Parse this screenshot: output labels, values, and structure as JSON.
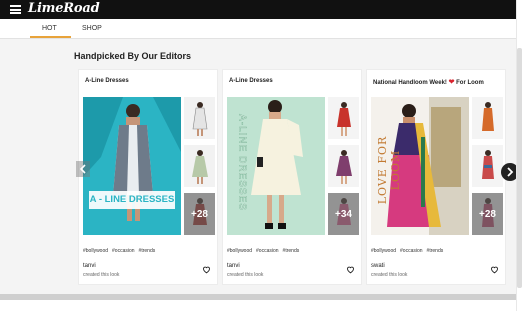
{
  "app": {
    "logo": "LimeRoad"
  },
  "tabs": [
    {
      "label": "HOT",
      "active": true
    },
    {
      "label": "SHOP",
      "active": false
    }
  ],
  "section": {
    "title": "Handpicked By Our Editors"
  },
  "cards": [
    {
      "title": "A-Line Dresses",
      "hero_text": "A - LINE DRESSES",
      "more_count": "+28",
      "tags": [
        "#bollywood",
        "#occasion",
        "#trends"
      ],
      "user": "tanvi",
      "created": "created this look"
    },
    {
      "title": "A-Line Dresses",
      "hero_text": "A-LINE DRESSES",
      "more_count": "+34",
      "tags": [
        "#bollywood",
        "#occasion",
        "#trends"
      ],
      "user": "tanvi",
      "created": "created this look"
    },
    {
      "title": "National Handloom Week!",
      "title_suffix": "For Loom",
      "hero_text": "LOVE FOR LOOM",
      "more_count": "+28",
      "tags": [
        "#bollywood",
        "#occasion",
        "#trends"
      ],
      "user": "swati",
      "created": "created this look"
    }
  ],
  "colors": {
    "topbar": "#111111",
    "accent": "#e8a33a",
    "hero1_bg": "#2bb4c4",
    "hero2_bg": "#bfe3d1",
    "hero3_bg": "#f4f1ec"
  },
  "icons": [
    "menu-icon",
    "heart-icon",
    "chevron-left-icon",
    "chevron-right-icon"
  ]
}
